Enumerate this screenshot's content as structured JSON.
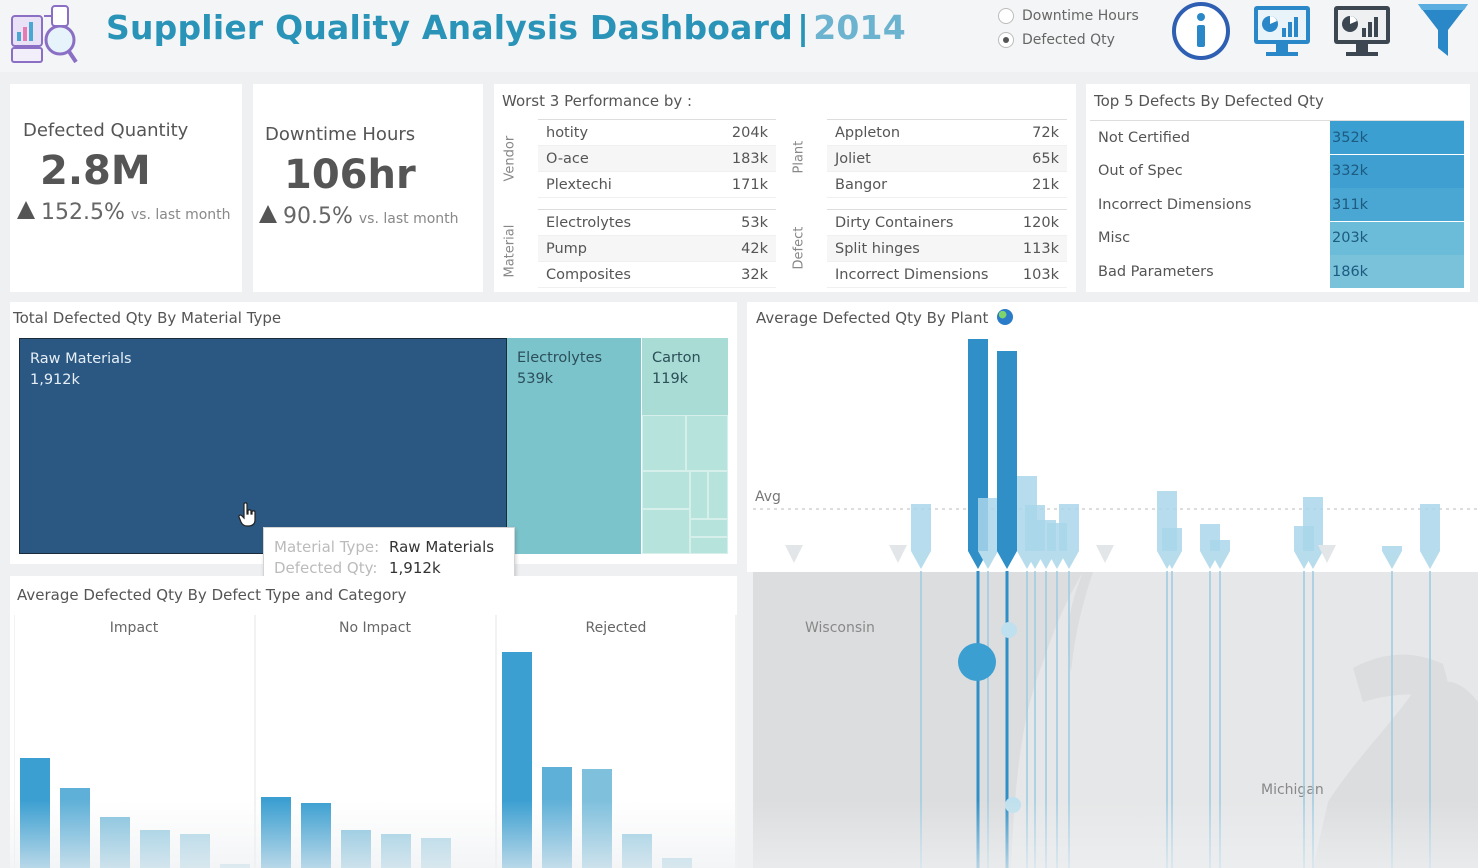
{
  "header": {
    "title": "Supplier Quality Analysis Dashboard",
    "separator": "|",
    "year": "2014",
    "measure_options": [
      {
        "label": "Downtime Hours",
        "selected": false
      },
      {
        "label": "Defected Qty",
        "selected": true
      }
    ],
    "icons": [
      "dashboard-logo-icon",
      "info-icon",
      "dashboard-1-icon",
      "dashboard-2-icon",
      "filter-icon"
    ]
  },
  "kpis": {
    "defected": {
      "label": "Defected Quantity",
      "value": "2.8M",
      "delta": "152.5%",
      "vs": "vs. last month"
    },
    "downtime": {
      "label": "Downtime Hours",
      "value": "106hr",
      "delta": "90.5%",
      "vs": "vs. last month"
    }
  },
  "worst3": {
    "title": "Worst 3 Performance by :",
    "vendor": {
      "label": "Vendor",
      "rows": [
        {
          "name": "hotity",
          "value": "204k"
        },
        {
          "name": "O-ace",
          "value": "183k"
        },
        {
          "name": "Plextechi",
          "value": "171k"
        }
      ]
    },
    "plant": {
      "label": "Plant",
      "rows": [
        {
          "name": "Appleton",
          "value": "72k"
        },
        {
          "name": "Joliet",
          "value": "65k"
        },
        {
          "name": "Bangor",
          "value": "21k"
        }
      ]
    },
    "material": {
      "label": "Material",
      "rows": [
        {
          "name": "Electrolytes",
          "value": "53k"
        },
        {
          "name": "Pump",
          "value": "42k"
        },
        {
          "name": "Composites",
          "value": "32k"
        }
      ]
    },
    "defect": {
      "label": "Defect",
      "rows": [
        {
          "name": "Dirty Containers",
          "value": "120k"
        },
        {
          "name": "Split hinges",
          "value": "113k"
        },
        {
          "name": "Incorrect Dimensions",
          "value": "103k"
        }
      ]
    }
  },
  "top5": {
    "title": "Top 5 Defects By Defected Qty",
    "rows": [
      {
        "name": "Not Certified",
        "value": "352k",
        "color": "#3b9fd1"
      },
      {
        "name": "Out of Spec",
        "value": "332k",
        "color": "#3f9fd0"
      },
      {
        "name": "Incorrect Dimensions",
        "value": "311k",
        "color": "#4aa6d2"
      },
      {
        "name": "Misc",
        "value": "203k",
        "color": "#6bbcd8"
      },
      {
        "name": "Bad Parameters",
        "value": "186k",
        "color": "#79c2da"
      }
    ]
  },
  "treemap": {
    "title": "Total Defected Qty By Material Type",
    "items": [
      {
        "name": "Raw Materials",
        "value": "1,912k",
        "color": "#2b5883"
      },
      {
        "name": "Electrolytes",
        "value": "539k",
        "color": "#7cc4cc"
      },
      {
        "name": "Carton",
        "value": "119k",
        "color": "#a8dcd5"
      }
    ],
    "tooltip": {
      "key1": "Material Type:",
      "val1": "Raw Materials",
      "key2": "Defected Qty:",
      "val2": "1,912k"
    }
  },
  "defect_chart": {
    "title": "Average  Defected Qty By Defect Type and Category",
    "facets": [
      "Impact",
      "No Impact",
      "Rejected"
    ]
  },
  "plant_chart": {
    "title": "Average Defected Qty By Plant",
    "avg_label": "Avg",
    "map_labels": [
      "Wisconsin",
      "Michigan"
    ]
  },
  "chart_data": [
    {
      "type": "treemap",
      "title": "Total Defected Qty By Material Type",
      "categories": [
        "Raw Materials",
        "Electrolytes",
        "Carton"
      ],
      "values": [
        1912,
        539,
        119
      ],
      "unit": "k"
    },
    {
      "type": "bar",
      "title": "Average  Defected Qty By Defect Type and Category",
      "facets": [
        {
          "name": "Impact",
          "values": [
            110,
            80,
            51,
            38,
            34,
            4
          ]
        },
        {
          "name": "No Impact",
          "values": [
            71,
            65,
            38,
            34,
            30
          ]
        },
        {
          "name": "Rejected",
          "values": [
            216,
            101,
            99,
            34,
            10
          ]
        }
      ]
    },
    {
      "type": "bar",
      "title": "Average Defected Qty By Plant",
      "values": [
        47,
        212,
        53,
        200,
        75,
        46,
        31,
        28,
        47,
        60,
        23,
        27,
        11,
        25,
        54,
        5,
        47
      ],
      "avg": 38
    }
  ]
}
